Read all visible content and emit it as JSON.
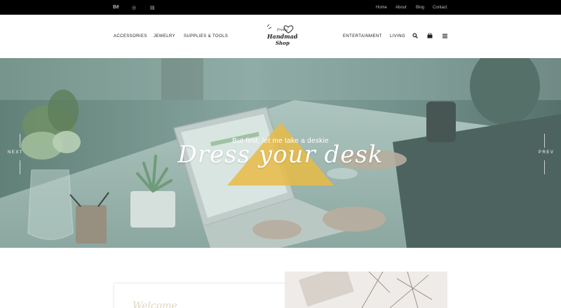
{
  "topbar": {
    "social": [
      {
        "label": "Bē",
        "icon": "behance-icon"
      },
      {
        "label": "◎",
        "icon": "dribbble-icon"
      },
      {
        "label": "▤",
        "icon": "flickr-icon"
      }
    ],
    "links": [
      "Home",
      "About",
      "Blog",
      "Contact"
    ]
  },
  "header": {
    "left_nav": [
      "ACCESSORIES",
      "JEWELRY",
      "SUPPLIES & TOOLS"
    ],
    "right_nav": [
      "ENTERTAINMENT",
      "LIVING"
    ],
    "logo": {
      "line1": "Pretty",
      "line2": "Handmade",
      "line3": "Shop"
    },
    "icons": {
      "search": "⚲",
      "cart": "▬",
      "menu": "≡"
    }
  },
  "hero": {
    "subtitle": "But first, let me take a deskie",
    "title": "Dress your desk",
    "next_label": "NEXT",
    "prev_label": "PREV",
    "triangle_color": "#e8bb45"
  },
  "content": {
    "card_script": "Welcome"
  },
  "colors": {
    "topbar_bg": "#000000",
    "accent": "#e8bb45",
    "hero_tint": "#6a8680"
  }
}
